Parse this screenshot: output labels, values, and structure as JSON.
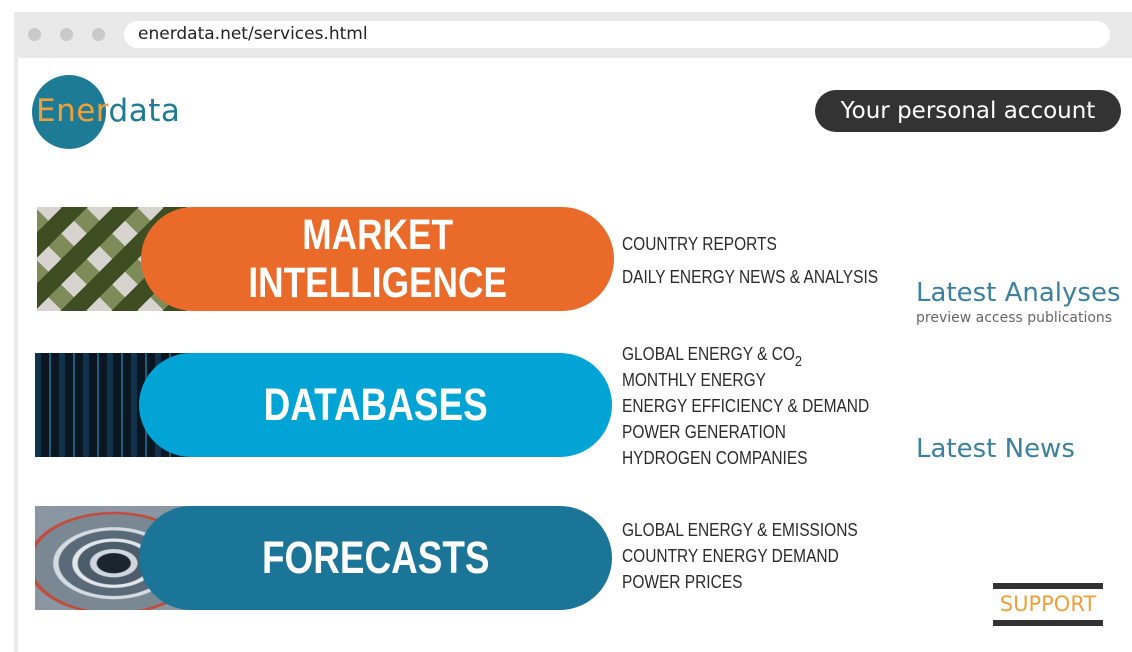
{
  "browser": {
    "url": "enerdata.net/services.html"
  },
  "logo": {
    "ener": "Ener",
    "data": "data"
  },
  "header": {
    "account_button": "Your personal account"
  },
  "services": {
    "market": {
      "line1": "MARKET",
      "line2": "INTELLIGENCE",
      "items": [
        "COUNTRY REPORTS",
        "DAILY ENERGY NEWS & ANALYSIS"
      ]
    },
    "databases": {
      "label": "DATABASES",
      "items": [
        {
          "text": "GLOBAL ENERGY & CO",
          "sub": "2"
        },
        "MONTHLY ENERGY",
        "ENERGY EFFICIENCY & DEMAND",
        "POWER GENERATION",
        "HYDROGEN COMPANIES"
      ]
    },
    "forecasts": {
      "label": "FORECASTS",
      "items": [
        "GLOBAL ENERGY & EMISSIONS",
        "COUNTRY ENERGY DEMAND",
        "POWER PRICES"
      ]
    }
  },
  "sidebar": {
    "latest_analyses": "Latest Analyses",
    "preview_text": "preview access publications",
    "latest_news": "Latest News",
    "support": "SUPPORT"
  },
  "colors": {
    "market": "#ea6a29",
    "databases": "#02a4d6",
    "forecasts": "#1a7598",
    "logo_circle": "#1e7b96",
    "accent_orange": "#f0a038"
  }
}
